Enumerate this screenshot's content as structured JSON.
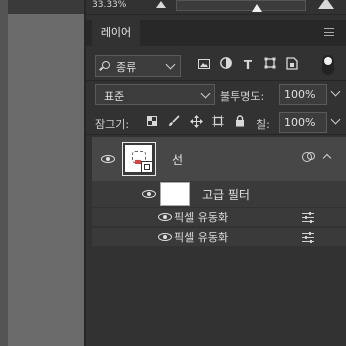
{
  "options_bar": {
    "zoom": "33.33%"
  },
  "panel": {
    "tab_label": "레이어",
    "filter": {
      "kind_label": "종류"
    },
    "blend": {
      "mode": "표준",
      "opacity_label": "불투명도:",
      "opacity": "100%"
    },
    "lock": {
      "label": "잠그기:",
      "fill_label": "칠:",
      "fill": "100%"
    },
    "layers": [
      {
        "name": "선",
        "smart_filter": {
          "label": "고급 필터",
          "effects": [
            "픽셀 유동화",
            "픽셀 유동화"
          ]
        }
      }
    ]
  },
  "colors": {
    "panel_bg": "#323232",
    "selected_layer": "#474747",
    "workspace": "#6b6b6b"
  }
}
